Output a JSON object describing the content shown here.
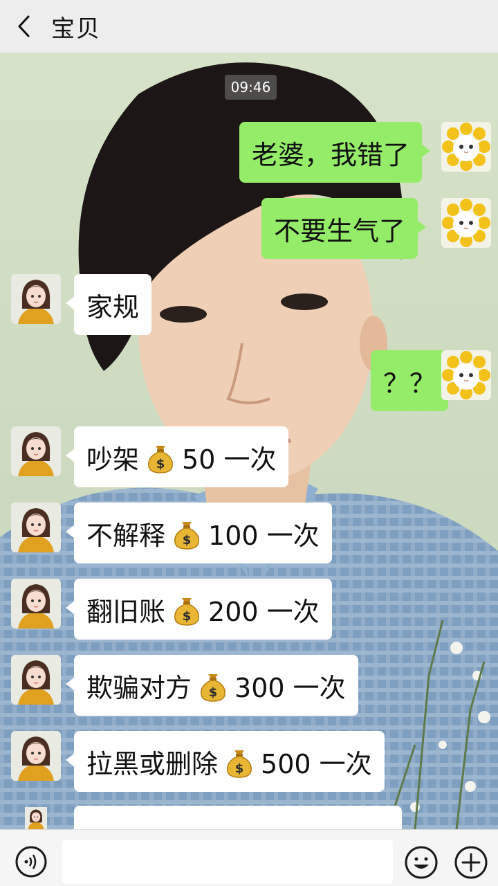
{
  "header": {
    "title": "宝贝",
    "back_icon": "chevron-left-icon"
  },
  "chat": {
    "timestamp": "09:46",
    "messages": [
      {
        "side": "right",
        "text": "老婆，我错了"
      },
      {
        "side": "right",
        "text": "不要生气了"
      },
      {
        "side": "left",
        "text": "家规"
      },
      {
        "side": "right",
        "text": "？？"
      },
      {
        "side": "left",
        "pre": "吵架",
        "post": "50 一次",
        "icon": "money-bag-icon"
      },
      {
        "side": "left",
        "pre": "不解释",
        "post": "100 一次",
        "icon": "money-bag-icon"
      },
      {
        "side": "left",
        "pre": "翻旧账",
        "post": "200 一次",
        "icon": "money-bag-icon"
      },
      {
        "side": "left",
        "pre": "欺骗对方",
        "post": "300 一次",
        "icon": "money-bag-icon"
      },
      {
        "side": "left",
        "pre": "拉黑或删除",
        "post": "500 一次",
        "icon": "money-bag-icon"
      }
    ]
  },
  "input_bar": {
    "voice_icon": "voice-icon",
    "emoji_icon": "emoji-icon",
    "plus_icon": "plus-icon",
    "input_value": ""
  },
  "colors": {
    "sent_bubble": "#95ec69",
    "received_bubble": "#ffffff",
    "header_bg": "#ededed"
  }
}
